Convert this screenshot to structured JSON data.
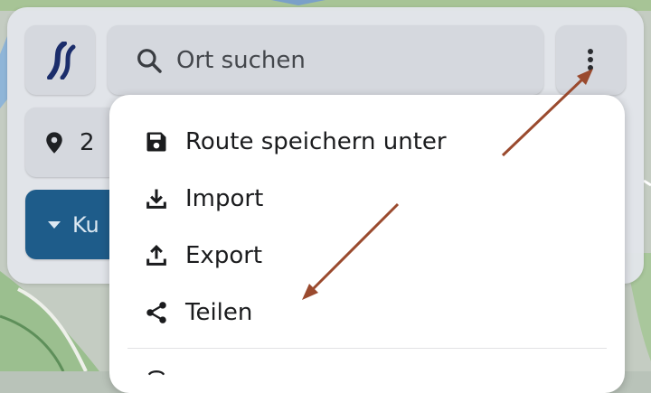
{
  "colors": {
    "panel": "#e2e5ea",
    "tile": "#d5d8de",
    "profile_accent": "#1e5c8a",
    "menu_bg": "#ffffff",
    "annotation_arrow": "#9a4a2e"
  },
  "header": {
    "logo_icon": "road-logo-icon",
    "search": {
      "placeholder": "Ort suchen",
      "icon": "search-icon"
    },
    "more_icon": "more-vertical-icon"
  },
  "waypoint": {
    "icon": "map-pin-icon",
    "text": "2"
  },
  "profile": {
    "icon": "caret-down-icon",
    "text": "Ku"
  },
  "menu": {
    "items": [
      {
        "label": "Route speichern unter",
        "icon": "save-icon"
      },
      {
        "label": "Import",
        "icon": "download-icon"
      },
      {
        "label": "Export",
        "icon": "upload-icon"
      },
      {
        "label": "Teilen",
        "icon": "share-icon"
      }
    ]
  }
}
